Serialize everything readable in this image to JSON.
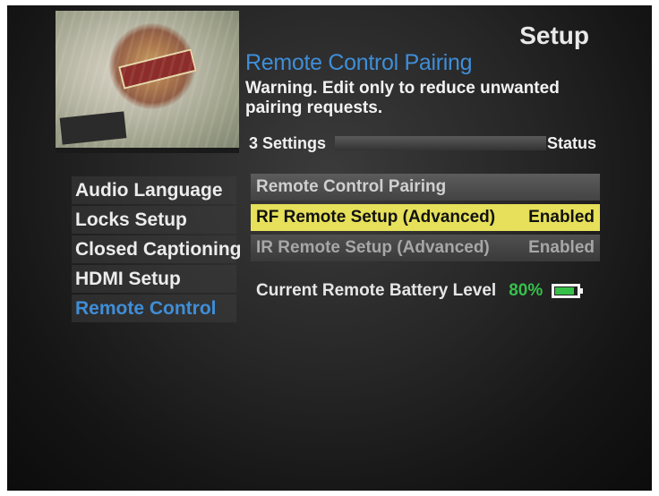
{
  "header": {
    "title": "Setup"
  },
  "screen": {
    "title": "Remote Control Pairing",
    "warning": "Warning. Edit only to reduce unwanted pairing requests."
  },
  "settings_header": {
    "count_label": "3 Settings",
    "status_label": "Status"
  },
  "sidebar": {
    "items": [
      {
        "label": "Audio Language"
      },
      {
        "label": "Locks Setup"
      },
      {
        "label": "Closed Captioning"
      },
      {
        "label": "HDMI Setup"
      },
      {
        "label": "Remote Control"
      }
    ],
    "active_index": 4
  },
  "options": [
    {
      "label": "Remote Control Pairing",
      "status": ""
    },
    {
      "label": "RF Remote Setup (Advanced)",
      "status": "Enabled"
    },
    {
      "label": "IR Remote Setup (Advanced)",
      "status": "Enabled"
    }
  ],
  "battery": {
    "label": "Current Remote Battery Level",
    "percent": "80%",
    "level": 0.8
  },
  "colors": {
    "accent_blue": "#3f8ed8",
    "highlight_yellow": "#e6e05a",
    "battery_green": "#36c04a"
  },
  "icons": {
    "battery": "battery-icon"
  }
}
